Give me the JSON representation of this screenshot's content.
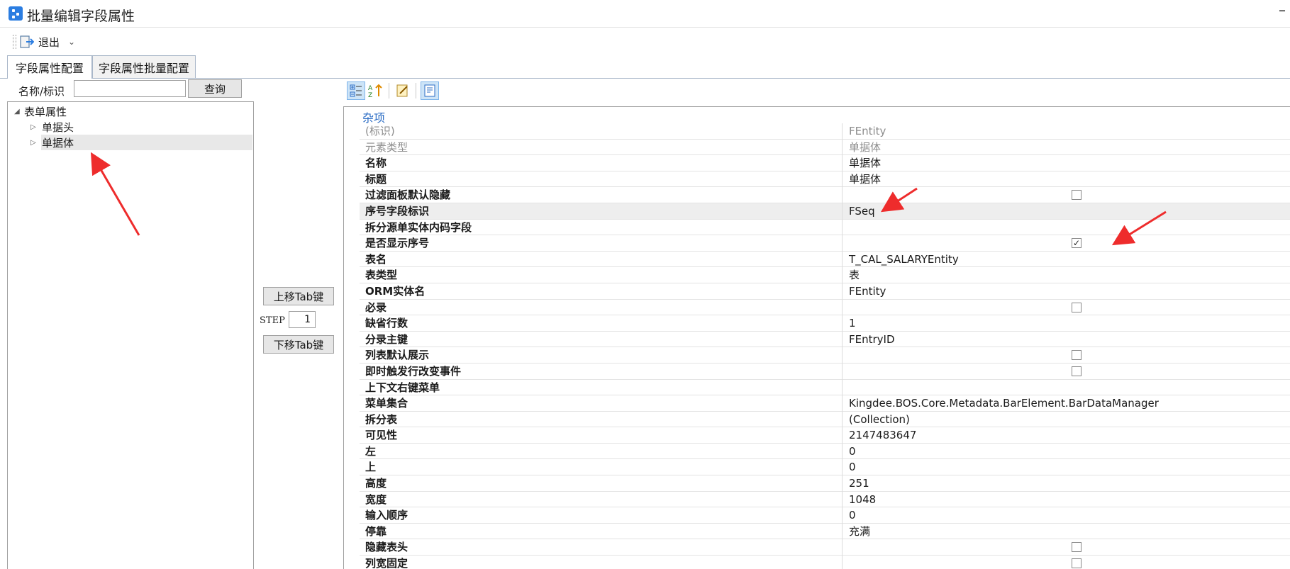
{
  "window": {
    "title": "批量编辑字段属性",
    "minimize_label": "–"
  },
  "toolbar": {
    "exit_label": "退出",
    "exit_dropdown_glyph": "⌄"
  },
  "tabs": [
    {
      "label": "字段属性配置",
      "active": true
    },
    {
      "label": "字段属性批量配置",
      "active": false
    }
  ],
  "search": {
    "label": "名称/标识",
    "value": "",
    "button_label": "查询"
  },
  "tree": {
    "root": {
      "label": "表单属性",
      "expanded": true
    },
    "children": [
      {
        "label": "单据头",
        "expanded": false
      },
      {
        "label": "单据体",
        "expanded": false,
        "selected": true
      }
    ]
  },
  "controls": {
    "move_up_label": "上移Tab键",
    "step_label": "STEP",
    "step_value": "1",
    "move_down_label": "下移Tab键"
  },
  "property_grid": {
    "toolbar_icons": [
      "categorized-icon",
      "alphabetical-sort-icon",
      "property-pages-icon",
      "description-pane-icon"
    ],
    "category": "杂项",
    "rows": [
      {
        "name": "(标识)",
        "value": "FEntity",
        "readonly": true
      },
      {
        "name": "元素类型",
        "value": "单据体",
        "readonly": true
      },
      {
        "name": "名称",
        "value": "单据体"
      },
      {
        "name": "标题",
        "value": "单据体"
      },
      {
        "name": "过滤面板默认隐藏",
        "checkbox": true,
        "checked": false
      },
      {
        "name": "序号字段标识",
        "value": "FSeq",
        "highlight": true
      },
      {
        "name": "拆分源单实体内码字段",
        "value": ""
      },
      {
        "name": "是否显示序号",
        "checkbox": true,
        "checked": true
      },
      {
        "name": "表名",
        "value": "T_CAL_SALARYEntity"
      },
      {
        "name": "表类型",
        "value": "表"
      },
      {
        "name": "ORM实体名",
        "value": "FEntity"
      },
      {
        "name": "必录",
        "checkbox": true,
        "checked": false
      },
      {
        "name": "缺省行数",
        "value": "1"
      },
      {
        "name": "分录主键",
        "value": "FEntryID"
      },
      {
        "name": "列表默认展示",
        "checkbox": true,
        "checked": false
      },
      {
        "name": "即时触发行改变事件",
        "checkbox": true,
        "checked": false
      },
      {
        "name": "上下文右键菜单",
        "value": ""
      },
      {
        "name": "菜单集合",
        "value": "Kingdee.BOS.Core.Metadata.BarElement.BarDataManager"
      },
      {
        "name": "拆分表",
        "value": "(Collection)"
      },
      {
        "name": "可见性",
        "value": "2147483647"
      },
      {
        "name": "左",
        "value": "0"
      },
      {
        "name": "上",
        "value": "0"
      },
      {
        "name": "高度",
        "value": "251"
      },
      {
        "name": "宽度",
        "value": "1048"
      },
      {
        "name": "输入顺序",
        "value": "0"
      },
      {
        "name": "停靠",
        "value": "充满"
      },
      {
        "name": "隐藏表头",
        "checkbox": true,
        "checked": false
      },
      {
        "name": "列宽固定",
        "checkbox": true,
        "checked": false
      }
    ]
  },
  "colors": {
    "accent": "#2b7de1",
    "category": "#2b6cc4",
    "annotation_arrow": "#ee2c2c"
  }
}
